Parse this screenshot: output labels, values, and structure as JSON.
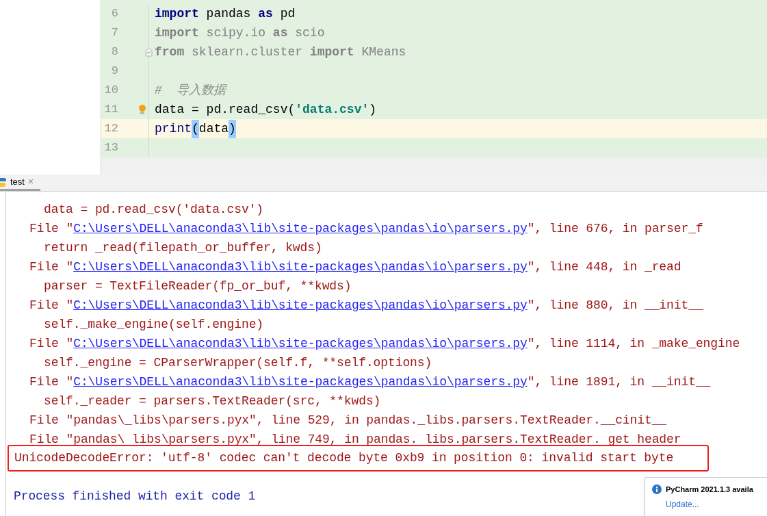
{
  "editor": {
    "lines": [
      {
        "number": "6",
        "selected": false,
        "tokens": [
          {
            "kind": "keyword",
            "text": "import"
          },
          {
            "kind": "plain",
            "text": " pandas "
          },
          {
            "kind": "keyword",
            "text": "as"
          },
          {
            "kind": "plain",
            "text": " pd"
          }
        ]
      },
      {
        "number": "7",
        "selected": false,
        "tokens": [
          {
            "kind": "unused_keyword",
            "text": "import"
          },
          {
            "kind": "unused",
            "text": " scipy.io "
          },
          {
            "kind": "unused_keyword",
            "text": "as"
          },
          {
            "kind": "unused",
            "text": " scio"
          }
        ]
      },
      {
        "number": "8",
        "selected": false,
        "tokens": [
          {
            "kind": "unused_keyword",
            "text": "from"
          },
          {
            "kind": "unused",
            "text": " sklearn.cluster "
          },
          {
            "kind": "unused_keyword",
            "text": "import"
          },
          {
            "kind": "unused",
            "text": " KMeans"
          }
        ]
      },
      {
        "number": "9",
        "selected": false
      },
      {
        "number": "10",
        "selected": false,
        "tokens": [
          {
            "kind": "comment",
            "text": "#  导入数据"
          }
        ]
      },
      {
        "number": "11",
        "selected": false,
        "tokens": [
          {
            "kind": "plain",
            "text": "data = pd.read_csv("
          },
          {
            "kind": "string",
            "text": "'data.csv'"
          },
          {
            "kind": "plain",
            "text": ")"
          }
        ]
      },
      {
        "number": "12",
        "selected": true,
        "tokens": [
          {
            "kind": "builtin",
            "text": "print"
          },
          {
            "kind": "brace_match",
            "text": "("
          },
          {
            "kind": "plain",
            "text": "data"
          },
          {
            "kind": "brace_match",
            "text": ")"
          }
        ]
      },
      {
        "number": "13",
        "selected": false
      }
    ]
  },
  "run_tab": {
    "label": "test",
    "close": "×"
  },
  "console": {
    "lines": [
      {
        "kind": "code",
        "text": "data = pd.read_csv('data.csv')"
      },
      {
        "kind": "file",
        "prefix": "File \"",
        "link": "C:\\Users\\DELL\\anaconda3\\lib\\site-packages\\pandas\\io\\parsers.py",
        "suffix": "\", line 676, in parser_f"
      },
      {
        "kind": "code",
        "text": "return _read(filepath_or_buffer, kwds)"
      },
      {
        "kind": "file",
        "prefix": "File \"",
        "link": "C:\\Users\\DELL\\anaconda3\\lib\\site-packages\\pandas\\io\\parsers.py",
        "suffix": "\", line 448, in _read"
      },
      {
        "kind": "code",
        "text": "parser = TextFileReader(fp_or_buf, **kwds)"
      },
      {
        "kind": "file",
        "prefix": "File \"",
        "link": "C:\\Users\\DELL\\anaconda3\\lib\\site-packages\\pandas\\io\\parsers.py",
        "suffix": "\", line 880, in __init__"
      },
      {
        "kind": "code",
        "text": "self._make_engine(self.engine)"
      },
      {
        "kind": "file",
        "prefix": "File \"",
        "link": "C:\\Users\\DELL\\anaconda3\\lib\\site-packages\\pandas\\io\\parsers.py",
        "suffix": "\", line 1114, in _make_engine"
      },
      {
        "kind": "code",
        "text": "self._engine = CParserWrapper(self.f, **self.options)"
      },
      {
        "kind": "file",
        "prefix": "File \"",
        "link": "C:\\Users\\DELL\\anaconda3\\lib\\site-packages\\pandas\\io\\parsers.py",
        "suffix": "\", line 1891, in __init__"
      },
      {
        "kind": "code",
        "text": "self._reader = parsers.TextReader(src, **kwds)"
      },
      {
        "kind": "plain",
        "text": "File \"pandas\\_libs\\parsers.pyx\", line 529, in pandas._libs.parsers.TextReader.__cinit__"
      },
      {
        "kind": "plain",
        "text": "File \"pandas\\ libs\\parsers.pyx\", line 749, in pandas. libs.parsers.TextReader. get header"
      }
    ],
    "error": "UnicodeDecodeError: 'utf-8' codec can't decode byte 0xb9 in position 0: invalid start byte",
    "exit": "Process finished with exit code 1"
  },
  "notification": {
    "title": "PyCharm 2021.1.3 availa",
    "link": "Update..."
  }
}
